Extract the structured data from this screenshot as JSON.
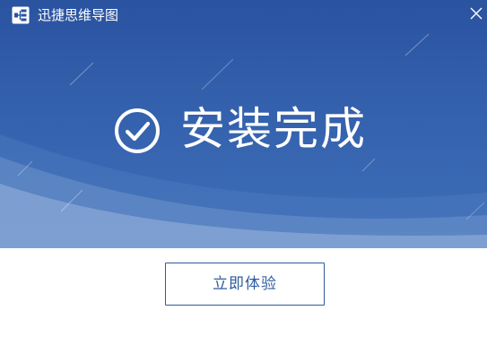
{
  "window": {
    "title": "迅捷思维导图"
  },
  "icons": {
    "app_logo": "mindmap-logo-icon",
    "close": "close-icon",
    "status": "check-circle-icon"
  },
  "status": {
    "message": "安装完成"
  },
  "actions": {
    "primary_label": "立即体验"
  },
  "colors": {
    "banner": "#2a53a0",
    "accent": "#2f5b9f",
    "text_on_banner": "#ffffff"
  }
}
